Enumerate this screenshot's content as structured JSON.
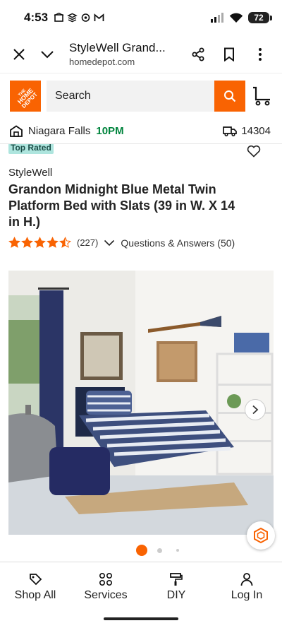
{
  "status_bar": {
    "time": "4:53",
    "battery": "72"
  },
  "browser": {
    "title": "StyleWell Grand...",
    "url": "homedepot.com"
  },
  "header": {
    "logo_text": "THE HOME DEPOT",
    "search_placeholder": "Search"
  },
  "store": {
    "name": "Niagara Falls",
    "hours": "10PM",
    "zip": "14304"
  },
  "product": {
    "badge": "Top Rated",
    "brand": "StyleWell",
    "title": "Grandon Midnight Blue Metal Twin Platform Bed with Slats (39 in W. X 14 in H.)",
    "rating": 4.5,
    "review_count": "(227)",
    "qa_link": "Questions & Answers (50)"
  },
  "carousel": {
    "current": 1,
    "total": 3
  },
  "bottom_nav": [
    {
      "label": "Shop All",
      "icon": "tag-icon"
    },
    {
      "label": "Services",
      "icon": "services-icon"
    },
    {
      "label": "DIY",
      "icon": "paint-roller-icon"
    },
    {
      "label": "Log In",
      "icon": "user-icon"
    }
  ],
  "colors": {
    "brand_orange": "#f96302",
    "store_green": "#00843d",
    "badge_teal": "#aee5de"
  }
}
